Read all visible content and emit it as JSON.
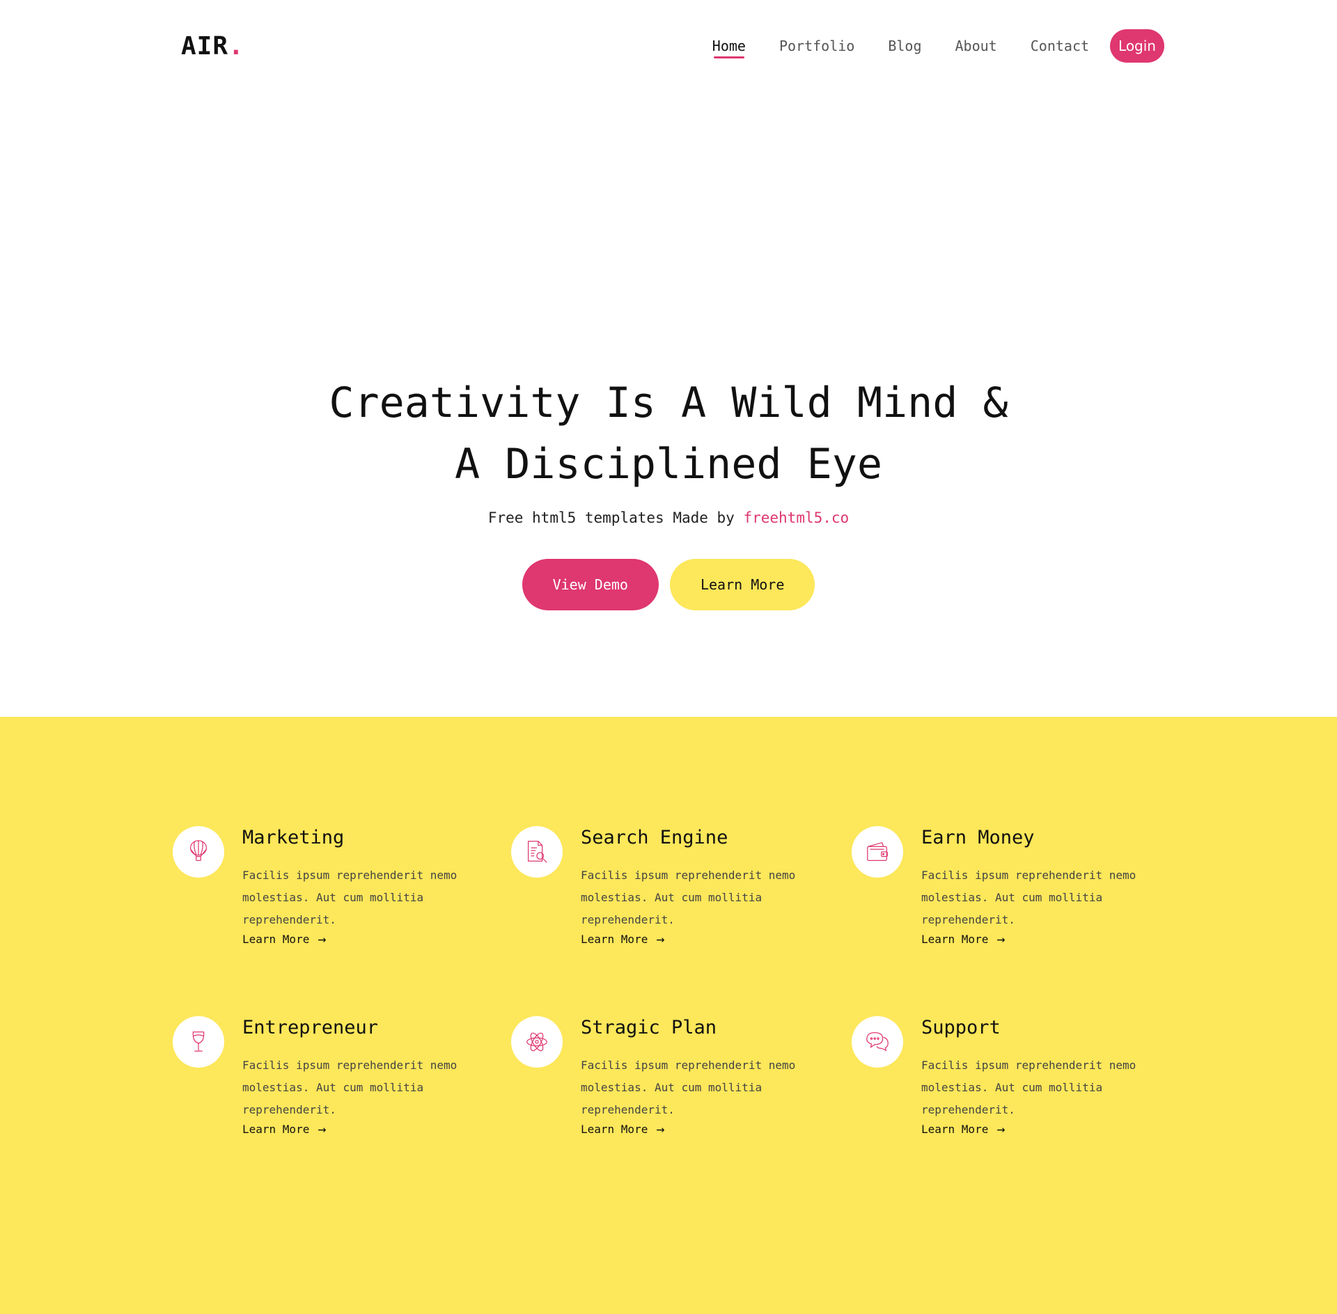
{
  "logo": {
    "text": "AIR",
    "dot": "."
  },
  "nav": {
    "items": [
      {
        "label": "Home"
      },
      {
        "label": "Portfolio"
      },
      {
        "label": "Blog"
      },
      {
        "label": "About"
      },
      {
        "label": "Contact"
      }
    ],
    "login_label": "Login"
  },
  "hero": {
    "title_line1": "Creativity Is A Wild Mind &",
    "title_line2": "A Disciplined Eye",
    "subtitle_prefix": "Free html5 templates Made by ",
    "subtitle_link": "freehtml5.co",
    "view_demo_label": "View Demo",
    "learn_more_label": "Learn More"
  },
  "features": [
    {
      "title": "Marketing",
      "text": "Facilis ipsum reprehenderit nemo molestias. Aut cum mollitia reprehenderit.",
      "link": "Learn More",
      "icon": "balloon-icon"
    },
    {
      "title": "Search Engine",
      "text": "Facilis ipsum reprehenderit nemo molestias. Aut cum mollitia reprehenderit.",
      "link": "Learn More",
      "icon": "document-search-icon"
    },
    {
      "title": "Earn Money",
      "text": "Facilis ipsum reprehenderit nemo molestias. Aut cum mollitia reprehenderit.",
      "link": "Learn More",
      "icon": "wallet-icon"
    },
    {
      "title": "Entrepreneur",
      "text": "Facilis ipsum reprehenderit nemo molestias. Aut cum mollitia reprehenderit.",
      "link": "Learn More",
      "icon": "wine-glass-icon"
    },
    {
      "title": "Stragic Plan",
      "text": "Facilis ipsum reprehenderit nemo molestias. Aut cum mollitia reprehenderit.",
      "link": "Learn More",
      "icon": "atom-icon"
    },
    {
      "title": "Support",
      "text": "Facilis ipsum reprehenderit nemo molestias. Aut cum mollitia reprehenderit.",
      "link": "Learn More",
      "icon": "chat-bubbles-icon"
    }
  ],
  "colors": {
    "accent": "#df3770",
    "yellow": "#fde75a",
    "text": "#111111"
  }
}
